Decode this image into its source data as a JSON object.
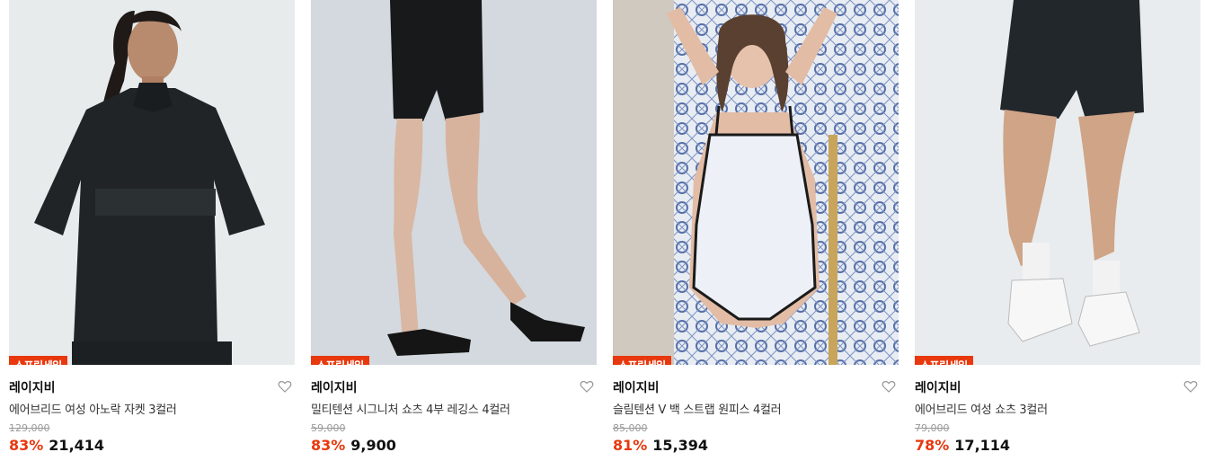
{
  "products": [
    {
      "badge": "스프링세일",
      "brand": "레이지비",
      "title": "에어브리드 여성 아노락 자켓 3컬러",
      "original_price": "129,000",
      "discount": "83%",
      "price": "21,414",
      "image_icon": "model-anorak-jacket-photo"
    },
    {
      "badge": "스프링세일",
      "brand": "레이지비",
      "title": "밀티텐션 시그니처 쇼츠 4부 레깅스 4컬러",
      "original_price": "59,000",
      "discount": "83%",
      "price": "9,900",
      "image_icon": "model-leggings-shorts-photo"
    },
    {
      "badge": "스프링세일",
      "brand": "레이지비",
      "title": "슬림텐션 V 백 스트랩 원피스 4컬러",
      "original_price": "85,000",
      "discount": "81%",
      "price": "15,394",
      "image_icon": "model-swimsuit-photo"
    },
    {
      "badge": "스프링세일",
      "brand": "레이지비",
      "title": "에어브리드 여성 쇼츠 3컬러",
      "original_price": "79,000",
      "discount": "78%",
      "price": "17,114",
      "image_icon": "model-shorts-photo"
    }
  ],
  "colors": {
    "sale_red": "#e8380d",
    "wishlist_icon": "heart-outline-icon"
  }
}
